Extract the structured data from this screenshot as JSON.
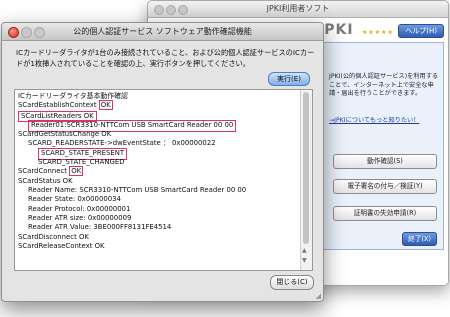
{
  "back_window": {
    "title": "JPKI利用者ソフト",
    "logo": "JPKI",
    "logo_stars": "★★★★★",
    "help_label": "ヘルプ(H)",
    "description": "JPKI(公的個人認証サービス)を利用することで、インターネット上で安全な申請・届出を行うことができます。",
    "link_text": "→JPKIについてもっと知りたい！",
    "buttons": {
      "check": "動作確認(S)",
      "sign": "電子署名の付与／検証(Y)",
      "cert": "証明書の失効申請(R)",
      "exit": "終了(X)"
    }
  },
  "dialog": {
    "title": "公的個人認証サービス ソフトウェア動作確認機能",
    "instructions": "ICカードリーダライタが1台のみ接続されていること、および公的個人認証サービスのICカードが1枚挿入されていることを確認の上、実行ボタンを押してください。",
    "run_label": "実行(E)",
    "close_label": "閉じる(C)",
    "log": [
      {
        "indent": 0,
        "text": "ICカードリーダライタ基本動作確認",
        "hl": ""
      },
      {
        "indent": 0,
        "text": "SCardEstablishContext ",
        "hl": "OK"
      },
      {
        "indent": 0,
        "text": "SCardListReaders OK",
        "hl": "",
        "boxed": true
      },
      {
        "indent": 1,
        "text": "Reader01:SCR3310-NTTCom USB SmartCard Reader 00 00",
        "hl": "",
        "boxed": true
      },
      {
        "indent": 0,
        "text": "SCardGetStatusChange OK",
        "hl": ""
      },
      {
        "indent": 1,
        "text": "SCARD_READERSTATE->dwEventState ： 0x00000022",
        "hl": ""
      },
      {
        "indent": 2,
        "text": "SCARD_STATE_PRESENT",
        "hl": "",
        "boxed": true
      },
      {
        "indent": 2,
        "text": "SCARD_STATE_CHANGED",
        "hl": ""
      },
      {
        "indent": 0,
        "text": "SCardConnect ",
        "hl": "OK"
      },
      {
        "indent": 0,
        "text": "SCardStatus OK",
        "hl": ""
      },
      {
        "indent": 1,
        "text": "Reader Name: SCR3310-NTTCom USB SmartCard Reader 00 00",
        "hl": ""
      },
      {
        "indent": 1,
        "text": "Reader State: 0x00000034",
        "hl": ""
      },
      {
        "indent": 1,
        "text": "Reader Protocol: 0x00000001",
        "hl": ""
      },
      {
        "indent": 1,
        "text": "Reader ATR size: 0x00000009",
        "hl": ""
      },
      {
        "indent": 1,
        "text": "Reader ATR Value: 3BE000FF8131FE4514",
        "hl": ""
      },
      {
        "indent": 0,
        "text": "SCardDisconnect OK",
        "hl": ""
      },
      {
        "indent": 0,
        "text": "SCardReleaseContext OK",
        "hl": ""
      }
    ]
  },
  "colors": {
    "highlight_box": "#d9336a",
    "primary_button": "#2d5db6"
  }
}
